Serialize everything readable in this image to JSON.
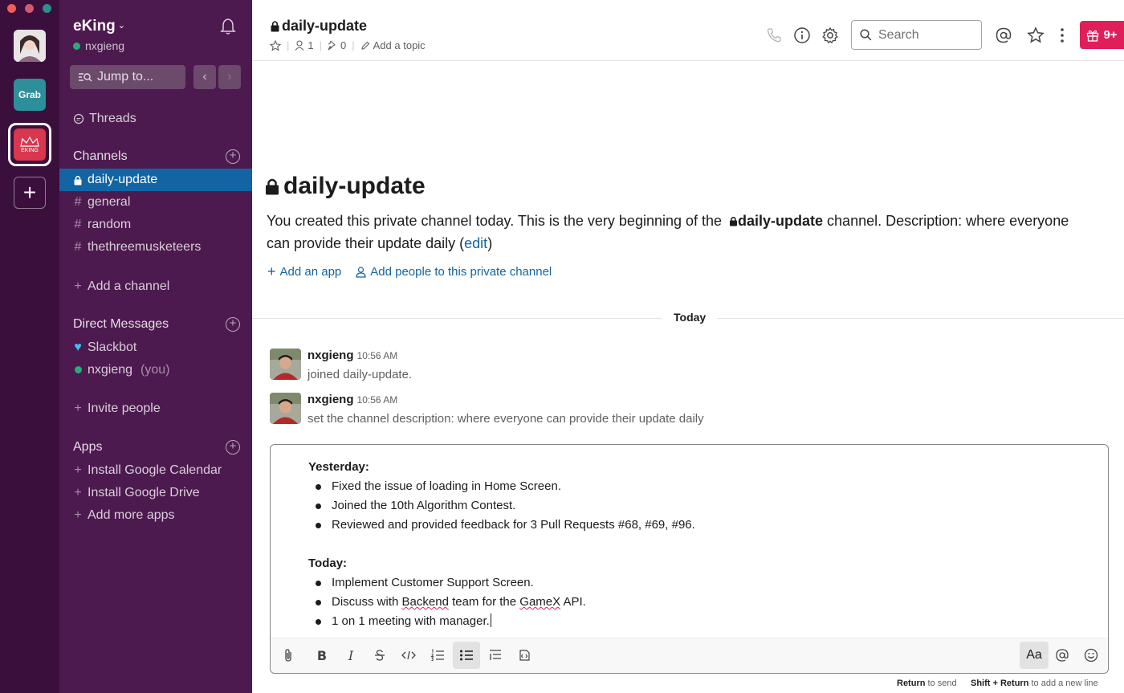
{
  "workspace": {
    "name": "eKing",
    "user": "nxgieng",
    "jump_label": "Jump to...",
    "grab_label": "Grab",
    "eking_label": "EKING"
  },
  "sidebar": {
    "threads": "Threads",
    "channels_heading": "Channels",
    "channels": [
      {
        "prefix": "lock",
        "name": "daily-update",
        "active": true
      },
      {
        "prefix": "#",
        "name": "general"
      },
      {
        "prefix": "#",
        "name": "random"
      },
      {
        "prefix": "#",
        "name": "thethreemusketeers"
      }
    ],
    "add_channel": "Add a channel",
    "dm_heading": "Direct Messages",
    "dms": [
      {
        "name": "Slackbot",
        "status": "heart"
      },
      {
        "name": "nxgieng",
        "suffix": "(you)",
        "status": "online"
      }
    ],
    "invite": "Invite people",
    "apps_heading": "Apps",
    "apps": [
      "Install Google Calendar",
      "Install Google Drive",
      "Add more apps"
    ]
  },
  "header": {
    "channel": "daily-update",
    "members": "1",
    "pins": "0",
    "add_topic": "Add a topic",
    "search_placeholder": "Search",
    "gift_badge": "9+"
  },
  "intro": {
    "title": "daily-update",
    "desc_part1": "You created this private channel today. This is the very beginning of the ",
    "desc_channel": "daily-update",
    "desc_part2": " channel. Description: where everyone can provide their update daily (",
    "desc_edit": "edit",
    "desc_close": ")",
    "add_app": "Add an app",
    "add_people": "Add people to this private channel"
  },
  "divider": "Today",
  "messages": [
    {
      "author": "nxgieng",
      "time": "10:56 AM",
      "text": "joined daily-update."
    },
    {
      "author": "nxgieng",
      "time": "10:56 AM",
      "text": "set the channel description: where everyone can provide their update daily"
    }
  ],
  "composer": {
    "yesterday_heading": "Yesterday:",
    "yesterday": [
      "Fixed the issue of loading in Home Screen.",
      "Joined the 10th Algorithm Contest.",
      "Reviewed and provided feedback for 3 Pull Requests #68, #69, #96."
    ],
    "today_heading": "Today:",
    "today_item1": "Implement Customer Support Screen.",
    "today_item2_a": "Discuss with ",
    "today_item2_b": "Backend",
    "today_item2_c": " team for the ",
    "today_item2_d": "GameX",
    "today_item2_e": " API.",
    "today_item3": "1 on 1 meeting with manager.",
    "format_label": "Aa",
    "bold_label": "B",
    "italic_label": "I"
  },
  "hints": {
    "return": "Return",
    "to_send": " to send",
    "shift_return": "Shift + Return",
    "new_line": " to add a new line"
  },
  "colors": {
    "rail": "#3b0f3c",
    "sidebar": "#4d1a4f",
    "active_channel": "#1264a3",
    "link": "#1264a3",
    "badge": "#e01e5a",
    "online": "#2bac76"
  }
}
